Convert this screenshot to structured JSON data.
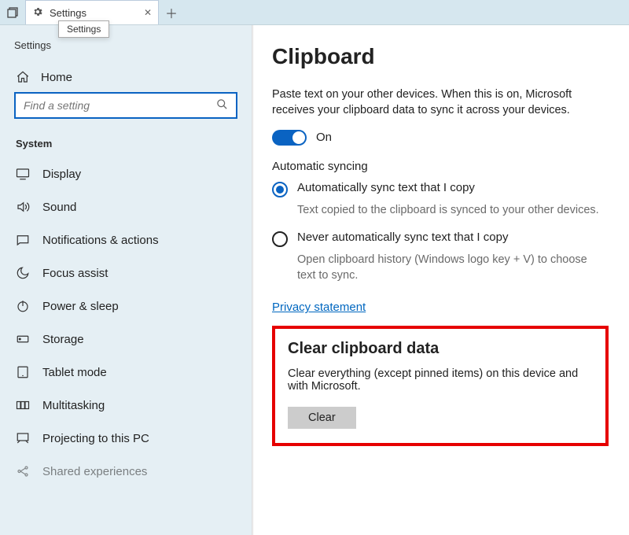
{
  "titlebar": {
    "tab_label": "Settings",
    "tooltip": "Settings"
  },
  "sidebar": {
    "app_title": "Settings",
    "home_label": "Home",
    "search_placeholder": "Find a setting",
    "group_label": "System",
    "items": [
      {
        "label": "Display"
      },
      {
        "label": "Sound"
      },
      {
        "label": "Notifications & actions"
      },
      {
        "label": "Focus assist"
      },
      {
        "label": "Power & sleep"
      },
      {
        "label": "Storage"
      },
      {
        "label": "Tablet mode"
      },
      {
        "label": "Multitasking"
      },
      {
        "label": "Projecting to this PC"
      },
      {
        "label": "Shared experiences"
      }
    ]
  },
  "content": {
    "page_title": "Clipboard",
    "sync_desc": "Paste text on your other devices. When this is on, Microsoft receives your clipboard data to sync it across your devices.",
    "toggle_label": "On",
    "auto_heading": "Automatic syncing",
    "radio1_label": "Automatically sync text that I copy",
    "radio1_sub": "Text copied to the clipboard is synced to your other devices.",
    "radio2_label": "Never automatically sync text that I copy",
    "radio2_sub": "Open clipboard history (Windows logo key + V) to choose text to sync.",
    "privacy_link": "Privacy statement",
    "clear_heading": "Clear clipboard data",
    "clear_desc": "Clear everything (except pinned items) on this device and with Microsoft.",
    "clear_button": "Clear"
  },
  "colors": {
    "accent": "#0a63c2",
    "highlight": "#e60000"
  }
}
